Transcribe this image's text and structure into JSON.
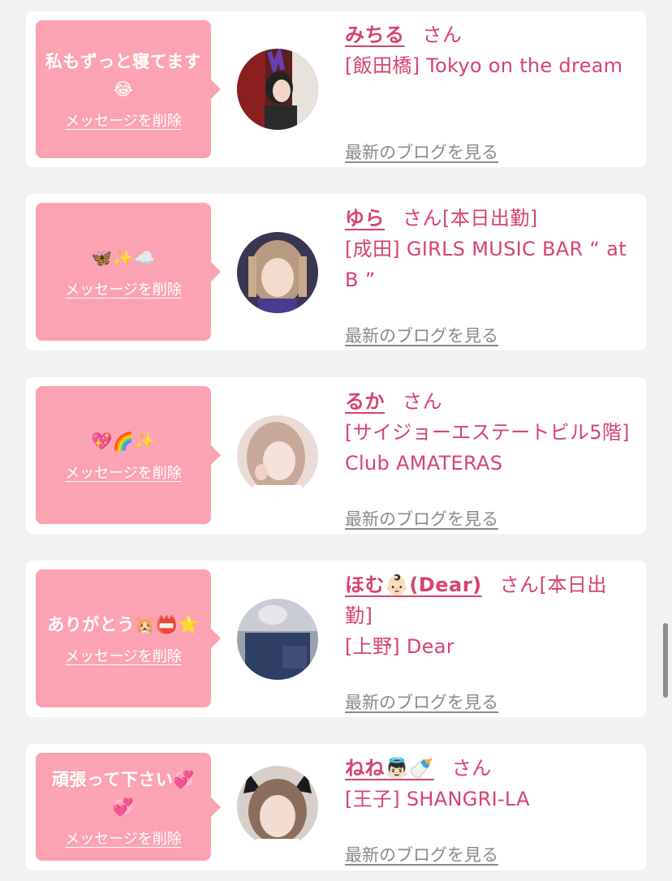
{
  "delete_label": "メッセージを削除",
  "blog_label": "最新のブログを見る",
  "colors": {
    "background": "#f2f2f2",
    "card": "#ffffff",
    "bubble": "#fca3b3",
    "accent_pink": "#d6446a",
    "link_gray": "#8a8a8a"
  },
  "messages": [
    {
      "message": "私もずっと寝てます😂",
      "name": "みちる",
      "honorific": "さん",
      "status": "",
      "shop": "[飯田橋] Tokyo on the dream"
    },
    {
      "message": "🦋✨☁️",
      "name": "ゆら",
      "honorific": "さん",
      "status": "[本日出勤]",
      "shop": "[成田] GIRLS MUSIC BAR “ at B ”"
    },
    {
      "message": "💖🌈✨",
      "name": "るか",
      "honorific": "さん",
      "status": "",
      "shop": "[サイジョーエステートビル5階] Club AMATERAS"
    },
    {
      "message": "ありがとう🐹📛⭐",
      "name": "ほむ👶🏻(Dear)",
      "honorific": "さん",
      "status": "[本日出勤]",
      "shop": "[上野] Dear"
    },
    {
      "message": "頑張って下さい💞💞",
      "name": "ねね👼🏻🍼",
      "honorific": "さん",
      "status": "",
      "shop": "[王子] SHANGRI-LA"
    }
  ]
}
